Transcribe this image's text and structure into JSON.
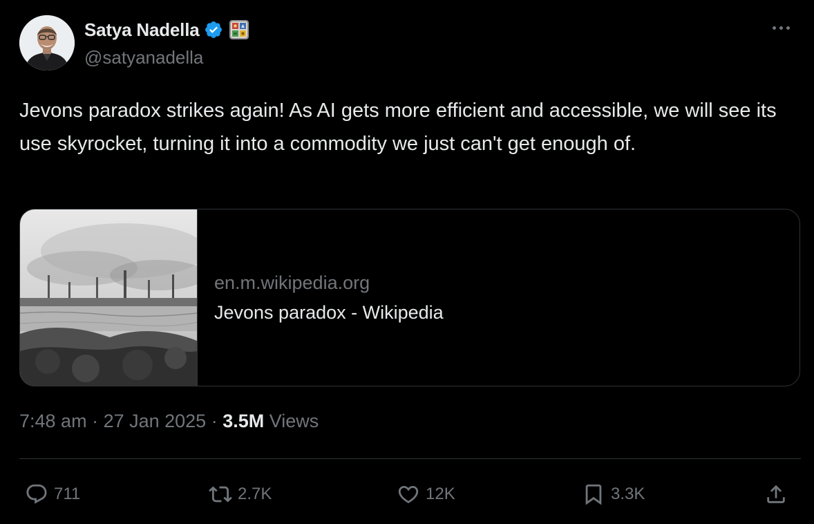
{
  "author": {
    "name": "Satya Nadella",
    "handle": "@satyanadella",
    "avatar_icon": "avatar-photo",
    "verified_icon": "verified-badge-icon",
    "affiliate_badge_icon": "affiliate-badge-icon"
  },
  "tweet": {
    "text": "Jevons paradox strikes again! As AI gets more efficient and accessible, we will see its use skyrocket, turning it into a commodity we just can't get enough of."
  },
  "link_card": {
    "domain": "en.m.wikipedia.org",
    "title": "Jevons paradox - Wikipedia",
    "image_icon": "industrial-landscape-engraving"
  },
  "meta": {
    "time": "7:48 am",
    "separator": " · ",
    "date": "27 Jan 2025",
    "views_count": "3.5M",
    "views_label": " Views"
  },
  "actions": {
    "reply_count": "711",
    "repost_count": "2.7K",
    "like_count": "12K",
    "bookmark_count": "3.3K"
  },
  "colors": {
    "background": "#000000",
    "text": "#e7e9ea",
    "muted": "#71767b",
    "border": "#2f3336",
    "verified": "#1d9bf0"
  }
}
